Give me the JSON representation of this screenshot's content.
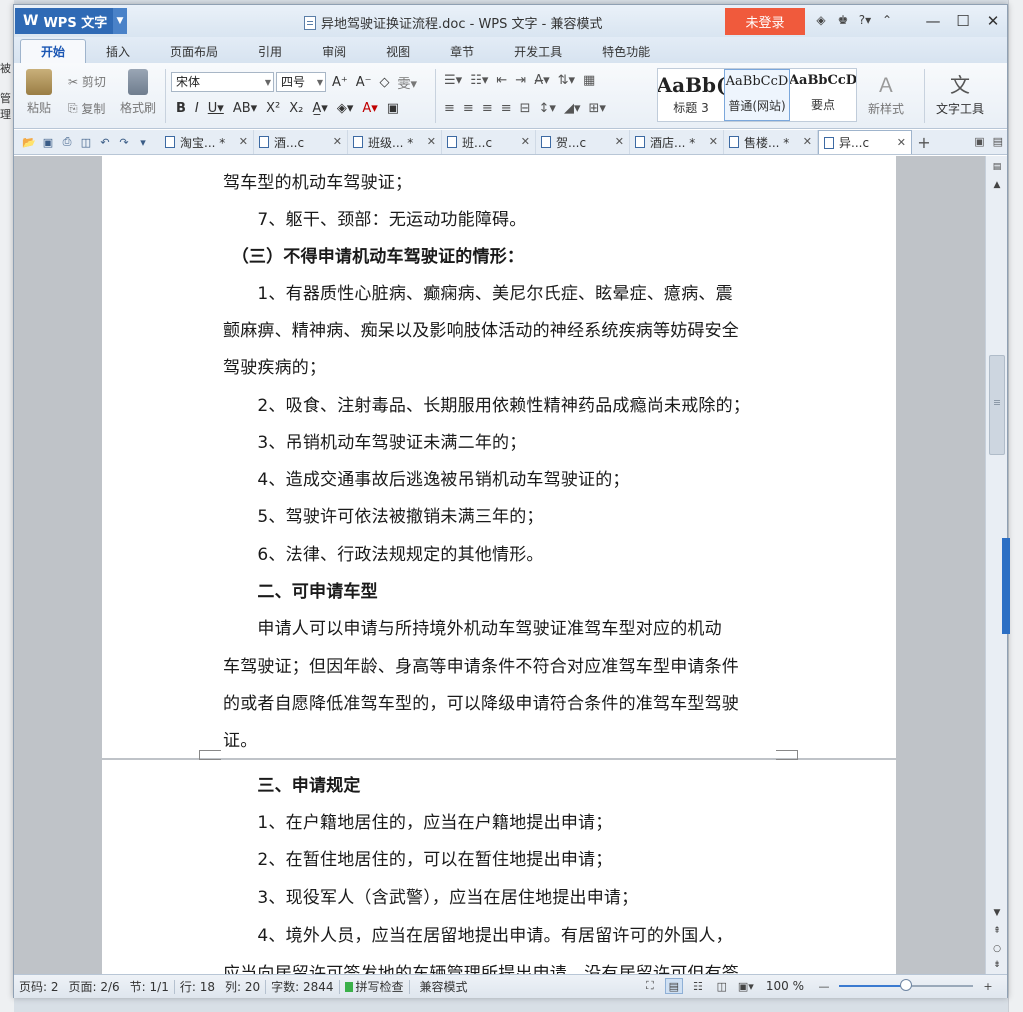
{
  "app": {
    "logo": "WPS 文字",
    "title": "异地驾驶证换证流程.doc - WPS 文字 - 兼容模式",
    "login": "未登录"
  },
  "desktop": {
    "left_text_1": "被",
    "left_text_2": "管理"
  },
  "ribbon_tabs": [
    "开始",
    "插入",
    "页面布局",
    "引用",
    "审阅",
    "视图",
    "章节",
    "开发工具",
    "特色功能"
  ],
  "ribbon": {
    "paste": "粘贴",
    "cut": "剪切",
    "copy": "复制",
    "format_painter": "格式刷",
    "font_name": "宋体",
    "font_size": "四号",
    "styles": [
      {
        "preview": "AaBb(",
        "label": "标题 3"
      },
      {
        "preview": "AaBbCcD",
        "label": "普通(网站)"
      },
      {
        "preview": "AaBbCcD",
        "label": "要点"
      }
    ],
    "new_style": "新样式",
    "text_tools": "文字工具"
  },
  "doc_tabs": [
    {
      "label": "淘宝... *",
      "active": false
    },
    {
      "label": "酒...c",
      "active": false
    },
    {
      "label": "班级... *",
      "active": false
    },
    {
      "label": "班...c",
      "active": false
    },
    {
      "label": "贺...c",
      "active": false
    },
    {
      "label": "酒店... *",
      "active": false
    },
    {
      "label": "售楼... *",
      "active": false
    },
    {
      "label": "异...c",
      "active": true
    }
  ],
  "page1": [
    {
      "text": "驾车型的机动车驾驶证；",
      "bold": false
    },
    {
      "text": "　　7、躯干、颈部：无运动功能障碍。",
      "bold": false
    },
    {
      "text": "　（三）不得申请机动车驾驶证的情形：",
      "bold": true
    },
    {
      "text": "　　1、有器质性心脏病、癫痫病、美尼尔氏症、眩晕症、癔病、震",
      "bold": false
    },
    {
      "text": "颤麻痹、精神病、痴呆以及影响肢体活动的神经系统疾病等妨碍安全",
      "bold": false
    },
    {
      "text": "驾驶疾病的；",
      "bold": false
    },
    {
      "text": "　　2、吸食、注射毒品、长期服用依赖性精神药品成瘾尚未戒除的；",
      "bold": false
    },
    {
      "text": "　　3、吊销机动车驾驶证未满二年的；",
      "bold": false
    },
    {
      "text": "　　4、造成交通事故后逃逸被吊销机动车驾驶证的；",
      "bold": false
    },
    {
      "text": "　　5、驾驶许可依法被撤销未满三年的；",
      "bold": false
    },
    {
      "text": "　　6、法律、行政法规规定的其他情形。",
      "bold": false
    },
    {
      "text": "　　二、可申请车型",
      "bold": true
    },
    {
      "text": "　　申请人可以申请与所持境外机动车驾驶证准驾车型对应的机动",
      "bold": false
    },
    {
      "text": "车驾驶证；但因年龄、身高等申请条件不符合对应准驾车型申请条件",
      "bold": false
    },
    {
      "text": "的或者自愿降低准驾车型的，可以降级申请符合条件的准驾车型驾驶",
      "bold": false
    },
    {
      "text": "证。",
      "bold": false
    }
  ],
  "page2": [
    {
      "text": "　　三、申请规定",
      "bold": true
    },
    {
      "text": "　　1、在户籍地居住的，应当在户籍地提出申请；",
      "bold": false
    },
    {
      "text": "　　2、在暂住地居住的，可以在暂住地提出申请；",
      "bold": false
    },
    {
      "text": "　　3、现役军人（含武警），应当在居住地提出申请；",
      "bold": false
    },
    {
      "text": "　　4、境外人员，应当在居留地提出申请。有居留许可的外国人，",
      "bold": false
    },
    {
      "text": "应当向居留许可签发地的车辆管理所提出申请，没有居留许可但有签",
      "bold": false
    }
  ],
  "status": {
    "page_code": "页码: 2",
    "pages": "页面: 2/6",
    "section": "节: 1/1",
    "row": "行: 18",
    "col": "列: 20",
    "words": "字数: 2844",
    "spell": "拼写检查",
    "compat": "兼容模式",
    "zoom": "100 %",
    "zoom_fraction": 0.5
  }
}
